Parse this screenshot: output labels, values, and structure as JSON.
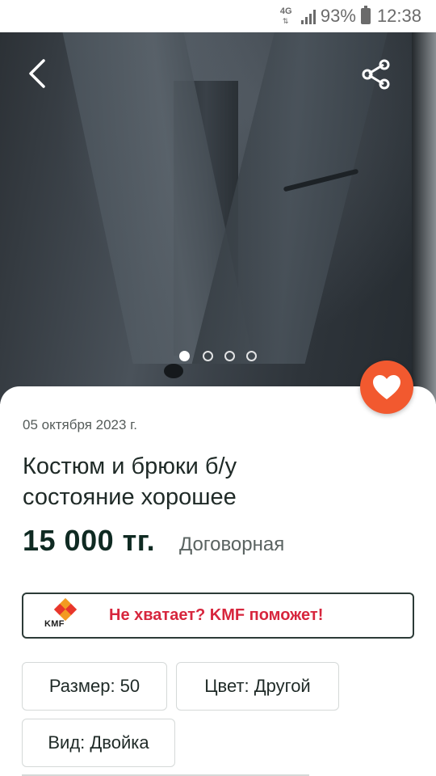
{
  "status_bar": {
    "network": "4G",
    "battery": "93%",
    "time": "12:38"
  },
  "gallery": {
    "photo_count": 4,
    "active_index": 0,
    "back_icon": "chevron-left-icon",
    "share_icon": "share-icon"
  },
  "favorite": {
    "icon": "heart-icon",
    "color": "#f2592f"
  },
  "listing": {
    "date": "05 октября 2023 г.",
    "title_line1": "Костюм и брюки б/у",
    "title_line2": "состояние хорошее",
    "price": "15 000 тг.",
    "negotiable": "Договорная"
  },
  "kmf_banner": {
    "logo_text": "KMF",
    "text": "Не хватает? KMF поможет!",
    "accent": "#d7263d"
  },
  "attributes": {
    "size": "Размер: 50",
    "color": "Цвет: Другой",
    "kind": "Вид: Двойка"
  }
}
